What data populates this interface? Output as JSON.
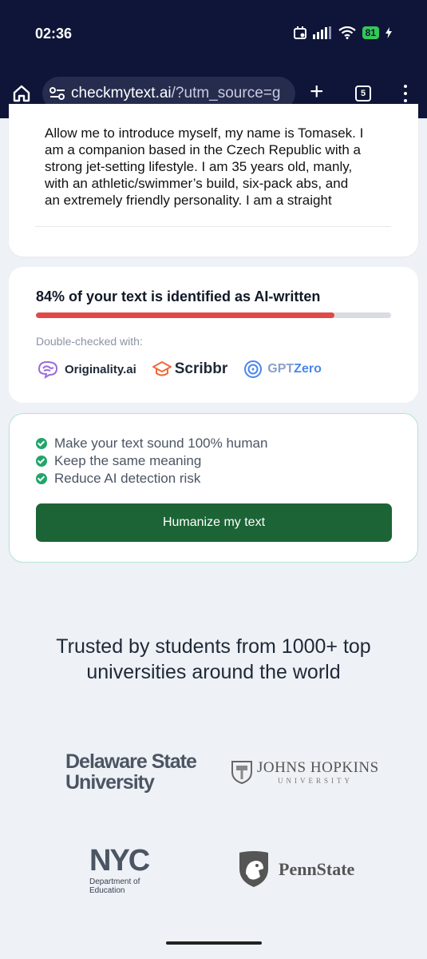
{
  "status_bar": {
    "time": "02:36",
    "battery": "81"
  },
  "browser": {
    "url_domain": "checkmytext.ai",
    "url_rest": "/?utm_source=g",
    "tab_count": "5"
  },
  "input_text": {
    "content": "Allow me to introduce myself, my name is Tomasek. I am a companion based in the Czech Republic with a strong jet-setting lifestyle. I am 35 years old, manly, with an athletic/swimmer’s build, six-pack abs, and an extremely friendly personality. I am a straight"
  },
  "result": {
    "headline": "84% of your text is identified as AI-written",
    "ai_fraction": 0.84,
    "double_checked_label": "Double-checked with:",
    "logos": {
      "originality": "Originality.ai",
      "scribbr": "Scribbr",
      "gpt": "GPT",
      "zero": "Zero"
    }
  },
  "humanize": {
    "benefits": [
      "Make your text sound 100% human",
      "Keep the same meaning",
      "Reduce AI detection risk"
    ],
    "button_label": "Humanize my text"
  },
  "trusted": {
    "line1": "Trusted by students from 1000+ top",
    "line2": "universities around the world",
    "universities": {
      "delaware_1": "Delaware State",
      "delaware_2": "University",
      "jhu": "JOHNS HOPKINS",
      "jhu_sub": "UNIVERSITY",
      "nyc_mark": "NYC",
      "nyc_dept_1": "Department of",
      "nyc_dept_2": "Education",
      "penn": "PennState"
    }
  },
  "colors": {
    "status_bg": "#0e1538",
    "progress_fill": "#e34848",
    "button_bg": "#1c6435",
    "check": "#22a56a"
  }
}
